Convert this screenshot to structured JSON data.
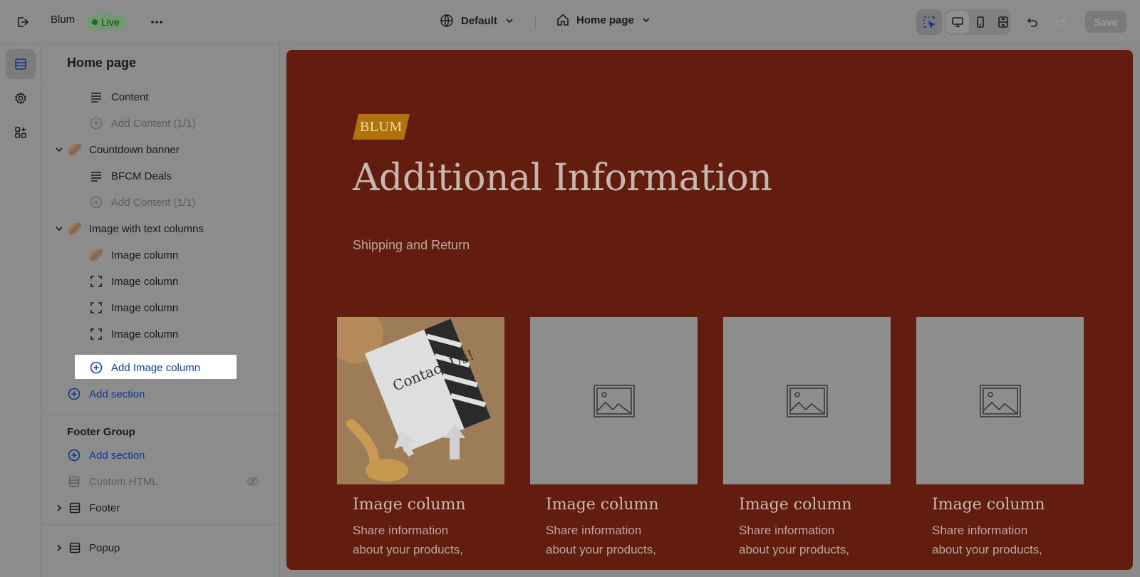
{
  "topbar": {
    "store_name": "Blum",
    "live_label": "Live",
    "theme_label": "Default",
    "page_label": "Home page",
    "save_label": "Save"
  },
  "sidebar": {
    "title": "Home page",
    "items": [
      {
        "label": "Content"
      },
      {
        "label": "Add Content (1/1)"
      },
      {
        "label": "Countdown banner"
      },
      {
        "label": "BFCM Deals"
      },
      {
        "label": "Add Content (1/1)"
      },
      {
        "label": "Image with text columns"
      },
      {
        "label": "Image column"
      },
      {
        "label": "Image column"
      },
      {
        "label": "Image column"
      },
      {
        "label": "Image column"
      },
      {
        "label": "Add Image column"
      },
      {
        "label": "Add section"
      }
    ],
    "footer_group": {
      "label": "Footer Group",
      "add_section": "Add section",
      "custom_html": "Custom HTML",
      "footer": "Footer",
      "popup": "Popup"
    }
  },
  "preview": {
    "logo_text": "BLUM",
    "title": "Additional Information",
    "subtitle": "Shipping and Return",
    "cards": [
      {
        "title": "Image column",
        "body": "Share information about your products,"
      },
      {
        "title": "Image column",
        "body": "Share information about your products,"
      },
      {
        "title": "Image column",
        "body": "Share information about your products,"
      },
      {
        "title": "Image column",
        "body": "Share information about your products,"
      }
    ],
    "photo_text": "Contact Us!"
  },
  "colors": {
    "preview_bg": "#621d0e",
    "link": "#0b3a8c",
    "live_badge": "#6f9b6f",
    "logo_bg": "#b0720a"
  }
}
